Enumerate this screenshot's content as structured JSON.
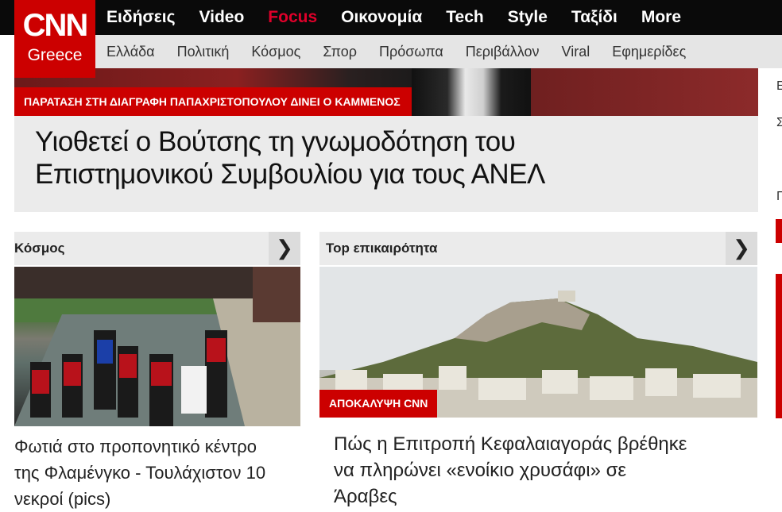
{
  "logo": {
    "main": "CNN",
    "sub": "Greece"
  },
  "main_nav": [
    {
      "label": "Ειδήσεις"
    },
    {
      "label": "Video"
    },
    {
      "label": "Focus"
    },
    {
      "label": "Οικονομία"
    },
    {
      "label": "Tech"
    },
    {
      "label": "Style"
    },
    {
      "label": "Ταξίδι"
    },
    {
      "label": "More"
    }
  ],
  "sub_nav": [
    {
      "label": "Ελλάδα"
    },
    {
      "label": "Πολιτική"
    },
    {
      "label": "Κόσμος"
    },
    {
      "label": "Σπορ"
    },
    {
      "label": "Πρόσωπα"
    },
    {
      "label": "Περιβάλλον"
    },
    {
      "label": "Viral"
    },
    {
      "label": "Εφημερίδες"
    }
  ],
  "hero": {
    "badge": "ΠΑΡΑΤΑΣΗ ΣΤΗ ΔΙΑΓΡΑΦΗ ΠΑΠΑΧΡΙΣΤΟΠΟΥΛΟΥ ΔΙΝΕΙ Ο ΚΑΜΜΕΝΟΣ",
    "headline_line1": "Υιοθετεί ο Βούτσης τη γνωμοδότηση του",
    "headline_line2": "Επιστημονικού Συμβουλίου για τους ΑΝΕΛ"
  },
  "sections": {
    "world": {
      "title": "Κόσμος",
      "arrow": "❯",
      "article_line1": "Φωτιά στο προπονητικό κέντρο",
      "article_line2": "της Φλαμένγκο - Τουλάχιστον 10",
      "article_line3": "νεκροί (pics)"
    },
    "top": {
      "title": "Top επικαιρότητα",
      "arrow": "❯",
      "badge": "ΑΠΟΚΑΛΥΨΗ CNN",
      "article_line1": "Πώς η Επιτροπή Κεφαλαιαγοράς βρέθηκε",
      "article_line2": "να πληρώνει «ενοίκιο χρυσάφι» σε",
      "article_line3": "Άραβες"
    }
  },
  "right_strip": {
    "letters": [
      "Ε",
      "Σ",
      "Π"
    ]
  },
  "colors": {
    "brand_red": "#cc0000",
    "focus_red": "#e0002a",
    "topbar": "#0a0a0a"
  }
}
